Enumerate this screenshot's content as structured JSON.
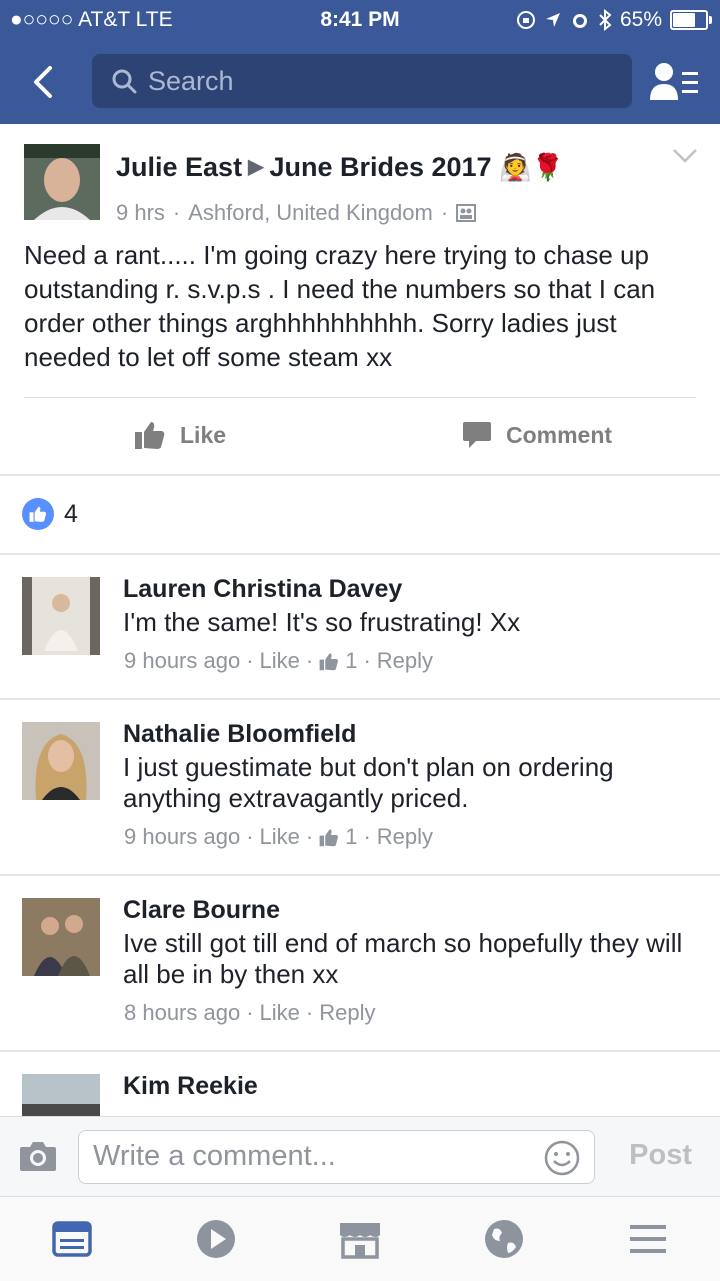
{
  "status_bar": {
    "carrier": "●○○○○ AT&T  LTE",
    "time": "8:41 PM",
    "battery": "65%",
    "battery_level": 0.65
  },
  "nav": {
    "search_placeholder": "Search",
    "icons": [
      "back-icon",
      "search-icon",
      "friends-menu-icon"
    ]
  },
  "post": {
    "author": "Julie East",
    "group": "June Brides 2017",
    "group_emoji": "👰🌹",
    "time": "9 hrs",
    "location": "Ashford, United Kingdom",
    "text": "Need a rant..... I'm going crazy here trying to chase up outstanding r. s.v.p.s .   I need the numbers so that I can order other things arghhhhhhhhhh.  Sorry ladies just needed to let off some steam xx",
    "like_label": "Like",
    "comment_label": "Comment",
    "like_count": "4"
  },
  "comments": [
    {
      "name": "Lauren Christina Davey",
      "text": "I'm the same! It's so frustrating! Xx",
      "time": "9 hours ago",
      "like_label": "Like",
      "likes": "1",
      "reply_label": "Reply"
    },
    {
      "name": "Nathalie Bloomfield",
      "text": "I just guestimate but don't plan on ordering anything extravagantly priced.",
      "time": "9 hours ago",
      "like_label": "Like",
      "likes": "1",
      "reply_label": "Reply"
    },
    {
      "name": "Clare Bourne",
      "text": "Ive still got till end of march so hopefully they will all be in by then xx",
      "time": "8 hours ago",
      "like_label": "Like",
      "reply_label": "Reply"
    },
    {
      "name": "Kim Reekie"
    }
  ],
  "composer": {
    "placeholder": "Write a comment...",
    "post_label": "Post"
  },
  "tabbar": {
    "tabs": [
      "news-feed-icon",
      "video-icon",
      "marketplace-icon",
      "notifications-globe-icon",
      "menu-icon"
    ],
    "active_color": "#4267b2",
    "inactive_color": "#8d949e"
  },
  "colors": {
    "brand": "#3b5998",
    "link_gray": "#90949c"
  }
}
